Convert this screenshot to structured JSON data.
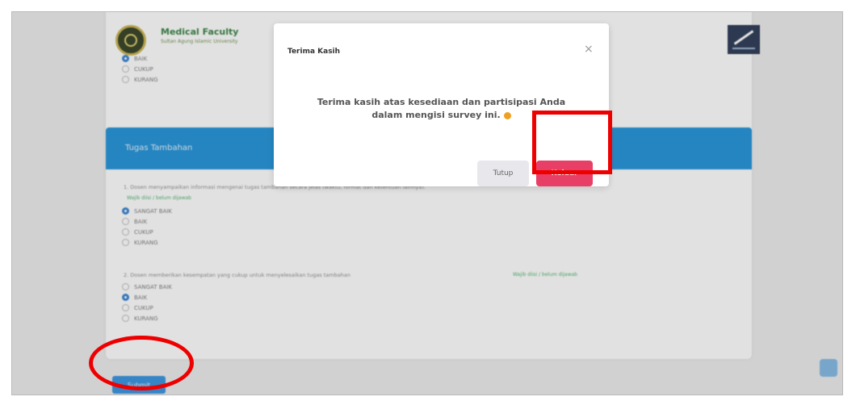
{
  "header": {
    "brand_title": "Medical Faculty",
    "brand_subtitle": "Sultan Agung Islamic University"
  },
  "top_options": [
    "BAIK",
    "CUKUP",
    "KURANG"
  ],
  "section": {
    "title": "Tugas Tambahan"
  },
  "questions": [
    {
      "text": "1. Dosen menyampaikan informasi mengenai tugas tambahan secara jelas (waktu, format dan ketentuan lainnya).",
      "hint": "Wajib diisi / belum dijawab",
      "options": [
        "SANGAT BAIK",
        "BAIK",
        "CUKUP",
        "KURANG"
      ],
      "selected": 0
    },
    {
      "text": "2. Dosen memberikan kesempatan yang cukup untuk menyelesaikan tugas tambahan",
      "hint": "Wajib diisi / belum dijawab",
      "options": [
        "SANGAT BAIK",
        "BAIK",
        "CUKUP",
        "KURANG"
      ],
      "selected": 1
    }
  ],
  "submit_label": "Submit",
  "modal": {
    "title": "Terima Kasih",
    "close_icon": "×",
    "message_line1": "Terima kasih atas kesediaan dan partisipasi Anda",
    "message_line2": "dalam mengisi survey ini.",
    "tutup_label": "Tutup",
    "keluar_label": "Keluar"
  },
  "colors": {
    "section_bar": "#1a8fd8",
    "keluar_button": "#e83f66",
    "annotation": "#ee0000"
  }
}
